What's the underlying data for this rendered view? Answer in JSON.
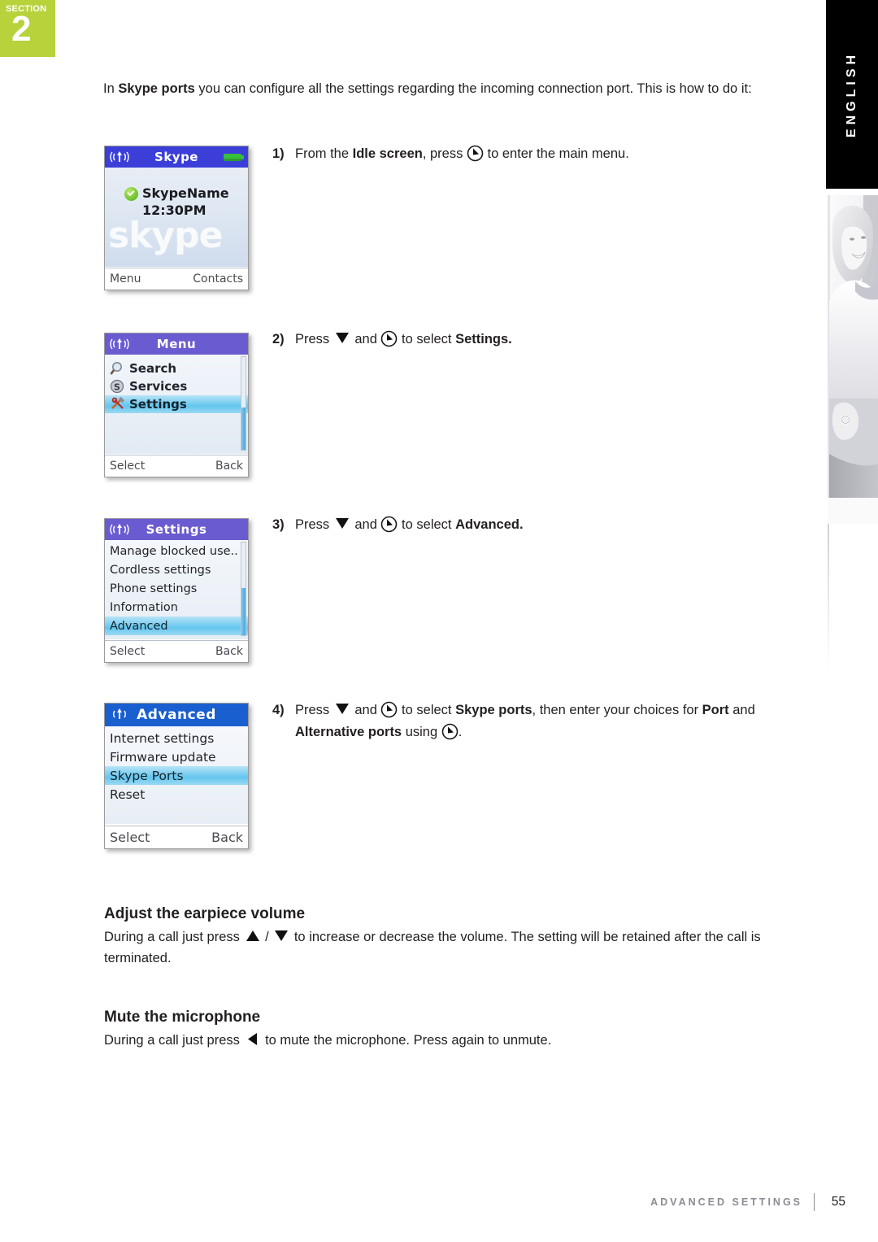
{
  "section_badge": {
    "word": "SECTION",
    "number": "2"
  },
  "sidebar": {
    "language_tab": "ENGLISH",
    "photo_alt": "woman-photo"
  },
  "intro": {
    "lead": "In ",
    "bold": "Skype ports",
    "rest": " you can configure all the settings regarding the incoming connection port. This is how to do it:"
  },
  "steps": [
    {
      "number": "1)",
      "p1": "From the ",
      "b1": "Idle screen",
      "p2": ", press ",
      "icon1": "nav-key-icon",
      "p3": " to enter the main menu.",
      "b2": "",
      "p4": "",
      "line2": ""
    },
    {
      "number": "2)",
      "p1": "Press ",
      "icon0": "down-triangle-icon",
      "p2": " and ",
      "icon1": "nav-key-icon",
      "p3": " to select ",
      "b1": "Settings.",
      "p4": ""
    },
    {
      "number": "3)",
      "p1": "Press ",
      "icon0": "down-triangle-icon",
      "p2": " and ",
      "icon1": "nav-key-icon",
      "p3": " to select ",
      "b1": "Advanced.",
      "p4": ""
    },
    {
      "number": "4)",
      "p1": "Press ",
      "icon0": "down-triangle-icon",
      "p2": " and ",
      "icon1": "nav-key-icon",
      "p3": " to select ",
      "b1": "Skype ports",
      "p4": ", then enter your choices for ",
      "b2": "Port",
      "p5": " and",
      "l2b1": "Alternative ports",
      "l2p1": " using ",
      "icon2": "nav-key-icon",
      "l2p2": "."
    }
  ],
  "phones": [
    {
      "name": "idle-screen",
      "title": "Skype",
      "title_color": "#3b3fd8",
      "signal_icon": "signal-antenna-icon",
      "battery_icon": "battery-icon",
      "user": "SkypeName",
      "time": "12:30PM",
      "watermark": "skype",
      "status_icon": "green-check-icon",
      "soft_left": "Menu",
      "soft_right": "Contacts"
    },
    {
      "name": "menu-screen",
      "title": "Menu",
      "title_color": "#6a5bd0",
      "signal_icon": "signal-antenna-icon",
      "items": [
        {
          "label": "Search",
          "icon": "magnifier-icon",
          "selected": false
        },
        {
          "label": "Services",
          "icon": "skype-s-icon",
          "selected": false
        },
        {
          "label": "Settings",
          "icon": "tools-icon",
          "selected": true
        }
      ],
      "soft_left": "Select",
      "soft_right": "Back"
    },
    {
      "name": "settings-screen",
      "title": "Settings",
      "title_color": "#6a5bd0",
      "signal_icon": "signal-antenna-icon",
      "items": [
        {
          "label": "Manage blocked use..",
          "selected": false
        },
        {
          "label": "Cordless settings",
          "selected": false
        },
        {
          "label": "Phone settings",
          "selected": false
        },
        {
          "label": "Information",
          "selected": false
        },
        {
          "label": "Advanced",
          "selected": true
        }
      ],
      "soft_left": "Select",
      "soft_right": "Back"
    },
    {
      "name": "advanced-screen",
      "title": "Advanced",
      "title_color": "#1a5fd0",
      "signal_icon": "signal-antenna-icon",
      "items": [
        {
          "label": "Internet settings",
          "selected": false
        },
        {
          "label": "Firmware update",
          "selected": false
        },
        {
          "label": "Skype Ports",
          "selected": true
        },
        {
          "label": "Reset",
          "selected": false
        }
      ],
      "soft_left": "Select",
      "soft_right": "Back"
    }
  ],
  "sections": [
    {
      "heading": "Adjust the earpiece volume",
      "p1": "During a call just press ",
      "icon_up": "up-triangle-icon",
      "sep": " / ",
      "icon_down": "down-triangle-icon",
      "p2": " to increase or decrease the volume. The setting will be retained after the call is terminated."
    },
    {
      "heading": "Mute the microphone",
      "p1": "During a call just press ",
      "icon_left": "left-triangle-icon",
      "p2": " to mute the microphone. Press again to unmute."
    }
  ],
  "footer": {
    "label": "ADVANCED SETTINGS",
    "page": "55"
  },
  "colors": {
    "section_green": "#b7d23b",
    "lang_black": "#000000",
    "selection_blue": "#63c6ee",
    "footer_gray": "#8b8b95"
  }
}
